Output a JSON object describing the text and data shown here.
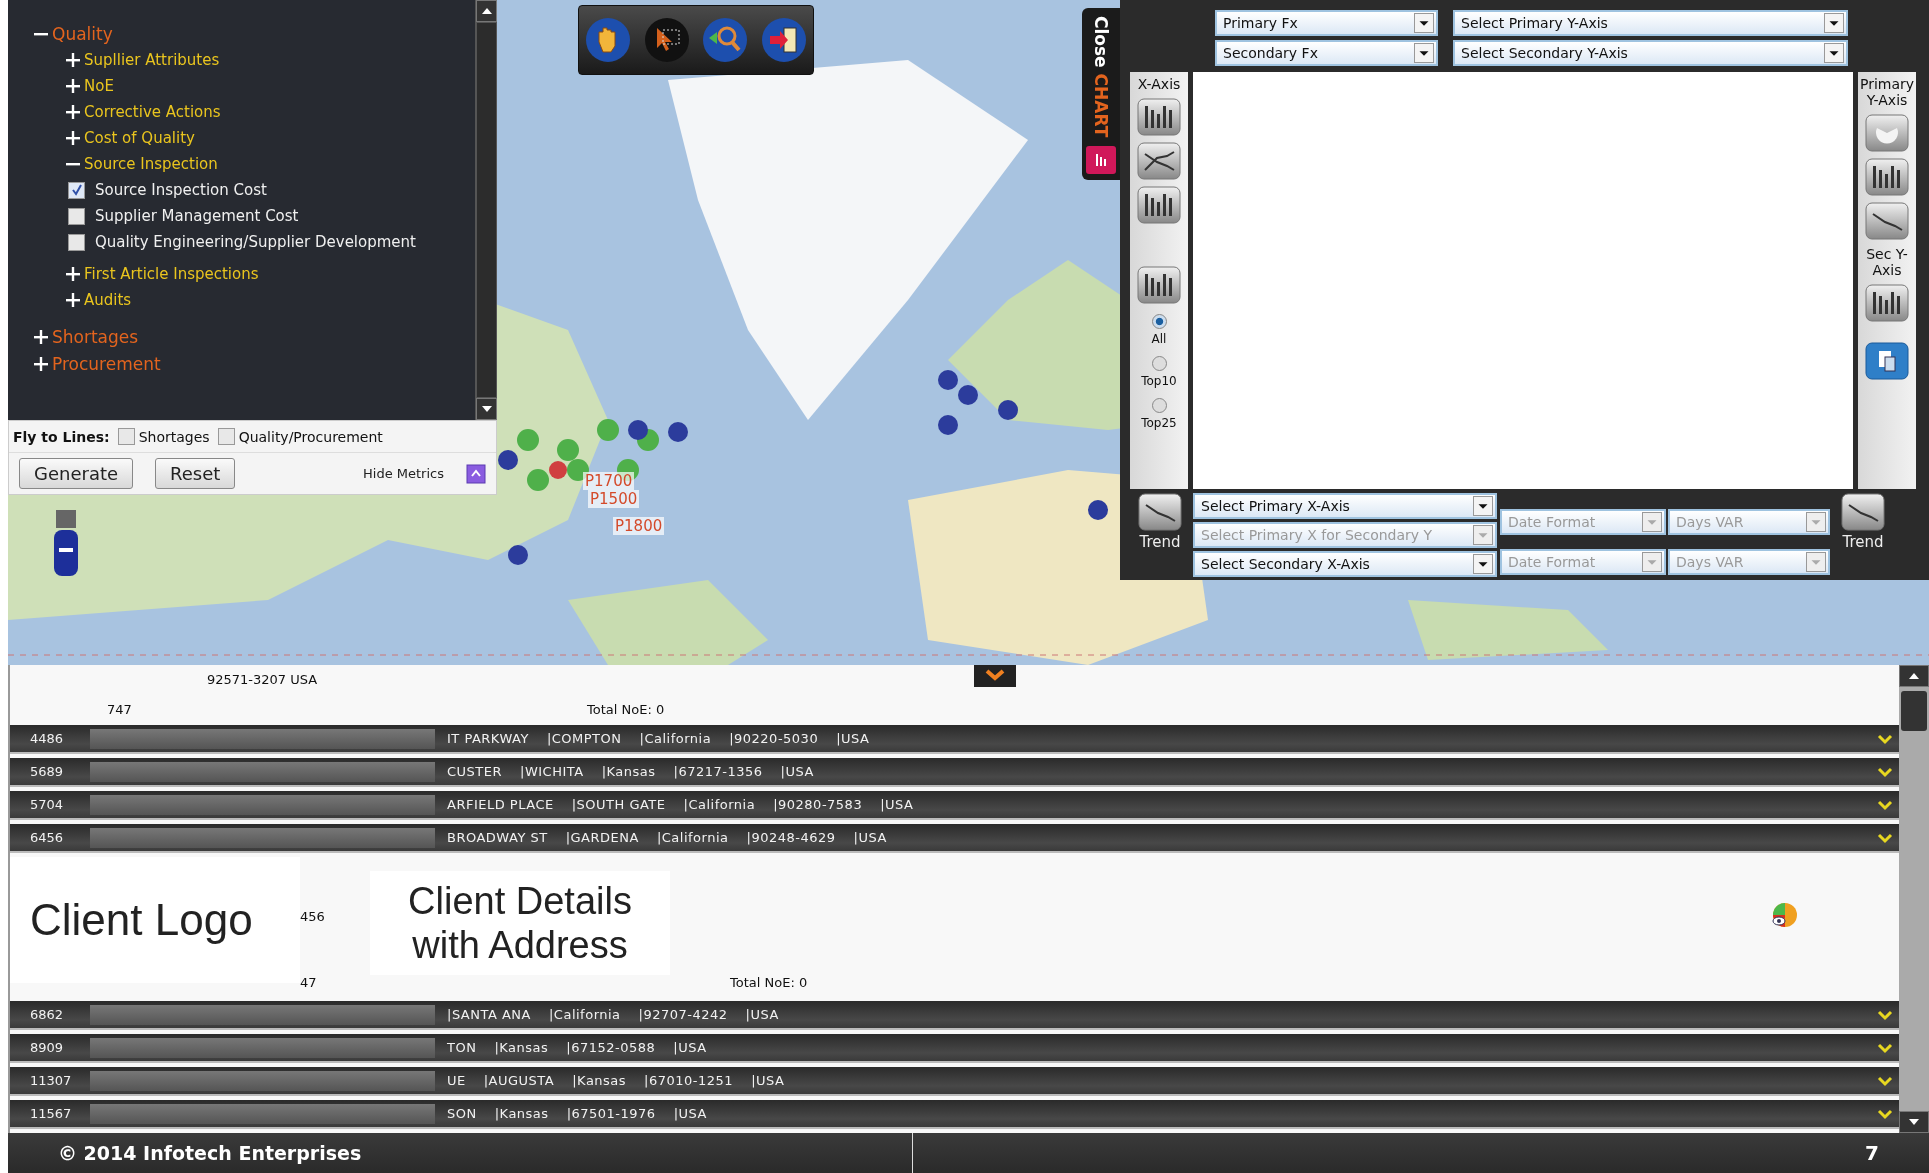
{
  "tree": [
    {
      "label": "Quality",
      "expanded": true,
      "children": [
        {
          "label": "Supllier Attributes",
          "expanded": false
        },
        {
          "label": "NoE",
          "expanded": false
        },
        {
          "label": "Corrective Actions",
          "expanded": false
        },
        {
          "label": "Cost of Quality",
          "expanded": false
        },
        {
          "label": "Source Inspection",
          "expanded": true,
          "children": [
            {
              "label": "Source Inspection Cost",
              "kind": "checkbox",
              "checked": true
            },
            {
              "label": "Supplier Management Cost",
              "kind": "checkbox",
              "checked": false
            },
            {
              "label": "Quality Engineering/Supplier Development",
              "kind": "checkbox",
              "checked": false
            }
          ]
        },
        {
          "label": "First Article Inspections",
          "expanded": false
        },
        {
          "label": "Audits",
          "expanded": false
        }
      ]
    },
    {
      "label": "Shortages",
      "expanded": false
    },
    {
      "label": "Procurement",
      "expanded": false
    }
  ],
  "fly_to_lines": {
    "label": "Fly to Lines:",
    "options": [
      {
        "label": "Shortages",
        "checked": false
      },
      {
        "label": "Quality/Procurement",
        "checked": false
      }
    ]
  },
  "buttons": [
    "Generate",
    "Reset"
  ],
  "hide_metrics": "Hide Metrics",
  "map": {
    "markers": [
      {
        "label": "P1700"
      },
      {
        "label": "P1500"
      },
      {
        "label": "P1800"
      }
    ]
  },
  "close_chart": {
    "close": "Close",
    "chart": "CHART"
  },
  "chart_panel": {
    "fx_selects": [
      "Primary Fx",
      "Secondary Fx"
    ],
    "y_selects": [
      "Select Primary Y-Axis",
      "Select Secondary Y-Axis"
    ],
    "x_axis_label": "X-Axis",
    "filters": [
      {
        "label": "All",
        "selected": true
      },
      {
        "label": "Top10",
        "selected": false
      },
      {
        "label": "Top25",
        "selected": false
      }
    ],
    "primary_y_label": "Primary Y-Axis",
    "sec_y_label": "Sec Y-Axis",
    "trend": [
      "Trend",
      "Trend"
    ],
    "x_selects": [
      {
        "label": "Select Primary X-Axis",
        "disabled": false
      },
      {
        "label": "Select Primary X for Secondary Y",
        "disabled": true
      },
      {
        "label": "Select Secondary X-Axis",
        "disabled": false
      }
    ],
    "date_formats": [
      {
        "label": "Date Format",
        "disabled": true
      },
      {
        "label": "Date Format",
        "disabled": true
      }
    ],
    "days_var": [
      {
        "label": "Days VAR",
        "disabled": true
      },
      {
        "label": "Days VAR",
        "disabled": true
      }
    ]
  },
  "list": {
    "header": {
      "address_tail": "92571-3207 USA",
      "id_tail": "747",
      "total": "Total NoE: 0"
    },
    "rows": [
      {
        "id": "4486",
        "parts": [
          "IT PARKWAY",
          "|COMPTON",
          "|California",
          "|90220-5030",
          "|USA"
        ]
      },
      {
        "id": "5689",
        "parts": [
          "CUSTER",
          "|WICHITA",
          "|Kansas",
          "|67217-1356",
          "|USA"
        ]
      },
      {
        "id": "5704",
        "parts": [
          "ARFIELD PLACE",
          "|SOUTH GATE",
          "|California",
          "|90280-7583",
          "|USA"
        ]
      },
      {
        "id": "6456",
        "parts": [
          "BROADWAY ST",
          "|GARDENA",
          "|California",
          "|90248-4629",
          "|USA"
        ]
      }
    ],
    "client": {
      "logo": "Client Logo",
      "id_tail": "456",
      "details": "Client Details with Address",
      "id_tail_2": "47",
      "total": "Total NoE: 0"
    },
    "rows_2": [
      {
        "id": "6862",
        "parts": [
          "|SANTA ANA",
          "|California",
          "|92707-4242",
          "|USA"
        ]
      },
      {
        "id": "8909",
        "parts": [
          "TON",
          "|Kansas",
          "|67152-0588",
          "|USA"
        ]
      },
      {
        "id": "11307",
        "parts": [
          "UE",
          "|AUGUSTA",
          "|Kansas",
          "|67010-1251",
          "|USA"
        ]
      },
      {
        "id": "11567",
        "parts": [
          "SON",
          "|Kansas",
          "|67501-1976",
          "|USA"
        ]
      }
    ]
  },
  "footer": {
    "copyright": "© 2014 Infotech Enterprises",
    "page": "7"
  }
}
